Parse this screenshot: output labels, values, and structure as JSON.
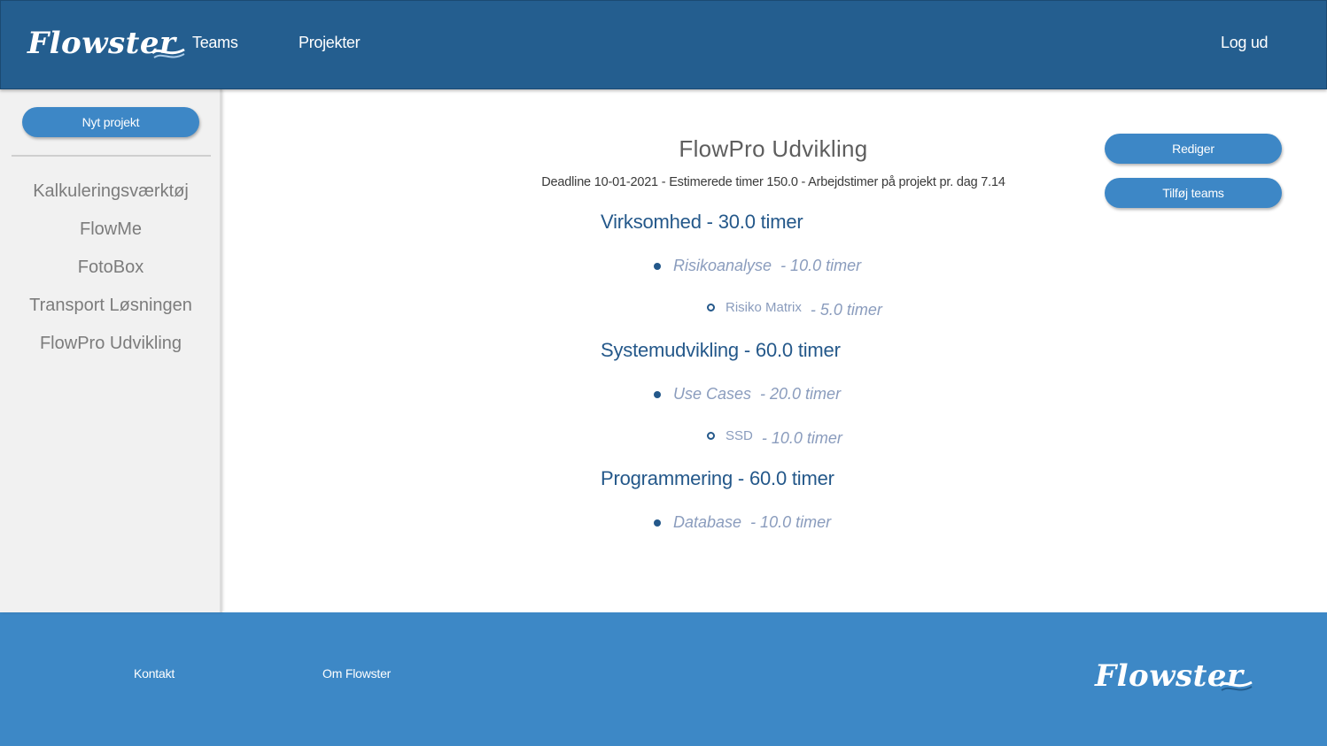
{
  "header": {
    "logo_text": "Flowster",
    "nav": {
      "teams": "Teams",
      "projekter": "Projekter"
    },
    "logout": "Log ud"
  },
  "sidebar": {
    "new_project_label": "Nyt projekt",
    "projects": [
      "Kalkuleringsværktøj",
      "FlowMe",
      "FotoBox",
      "Transport Løsningen",
      "FlowPro Udvikling"
    ]
  },
  "main": {
    "title": "FlowPro Udvikling",
    "meta": "Deadline 10-01-2021 - Estimerede timer 150.0 - Arbejdstimer på projekt pr. dag 7.14",
    "buttons": {
      "edit": "Rediger",
      "add_teams": "Tilføj teams"
    },
    "phases": [
      {
        "name": "Virksomhed",
        "hours": " - 30.0 timer",
        "task": {
          "name": "Risikoanalyse",
          "hours": " - 10.0 timer"
        },
        "subtask": {
          "name": "Risiko Matrix",
          "hours": " - 5.0 timer"
        }
      },
      {
        "name": "Systemudvikling",
        "hours": " - 60.0 timer",
        "task": {
          "name": "Use Cases",
          "hours": " - 20.0 timer"
        },
        "subtask": {
          "name": "SSD",
          "hours": " - 10.0 timer"
        }
      },
      {
        "name": "Programmering",
        "hours": " - 60.0 timer",
        "task": {
          "name": "Database",
          "hours": " - 10.0 timer"
        }
      }
    ]
  },
  "footer": {
    "kontakt": "Kontakt",
    "om": "Om Flowster",
    "logo_text": "Flowster"
  },
  "colors": {
    "header_bg": "#245e8f",
    "footer_bg": "#3d88c6",
    "button_bg": "#3d87c6",
    "sidebar_bg": "#f1f1f1",
    "phase_text": "#24588a",
    "task_text": "#8a9cbd"
  }
}
